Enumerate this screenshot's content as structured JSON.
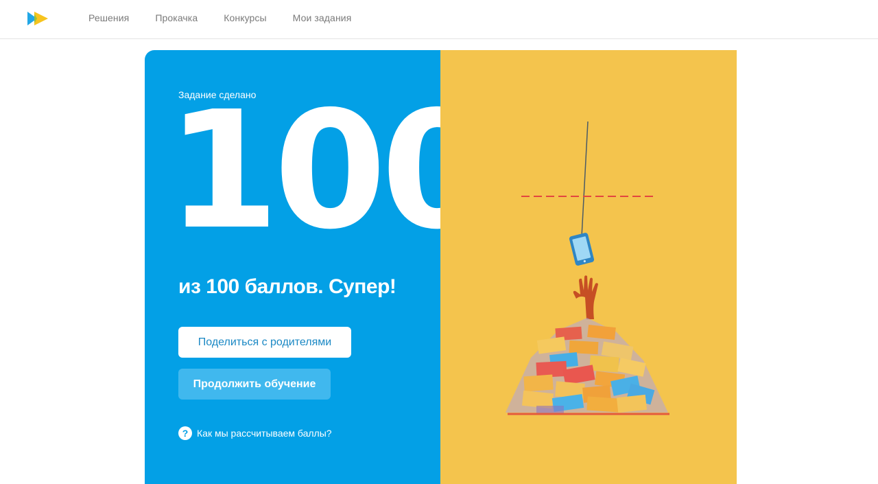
{
  "header": {
    "logo_icon": "play-logo-icon",
    "nav": [
      {
        "label": "Решения"
      },
      {
        "label": "Прокачка"
      },
      {
        "label": "Конкурсы"
      },
      {
        "label": "Мои задания"
      }
    ]
  },
  "result": {
    "status_label": "Задание сделано",
    "score": "100",
    "score_caption": "из 100 баллов. Супер!",
    "share_button": "Поделиться с родителями",
    "continue_button": "Продолжить обучение",
    "help_icon": "question-circle-icon",
    "help_link": "Как мы рассчитываем баллы?"
  },
  "colors": {
    "left_panel": "#03a0e6",
    "right_panel": "#f4c44d",
    "continue_button": "#40b8ee",
    "accent_text": "#1a88c4"
  }
}
